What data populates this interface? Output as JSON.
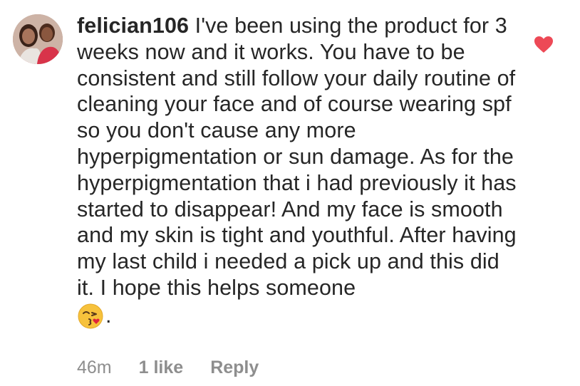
{
  "comment": {
    "username": "felician106",
    "text": "I've been using the product for 3 weeks now and it works. You have to be consistent and still follow your daily routine of cleaning your face and of course wearing spf so you don't cause any more hyperpigmentation or sun damage. As for the hyperpigmentation that i had previously it has started to disappear! And my face is smooth and my skin is tight and youthful. After having my last child i needed a pick up and this did it. I hope this helps someone",
    "emoji": "kissing-face-with-heart",
    "trailing": ".",
    "time": "46m",
    "likes": "1 like",
    "reply_label": "Reply",
    "liked": true
  },
  "colors": {
    "text": "#262626",
    "meta": "#8e8e8e",
    "heart": "#ed4956"
  },
  "icons": {
    "avatar": "user-avatar",
    "like": "heart-icon"
  }
}
